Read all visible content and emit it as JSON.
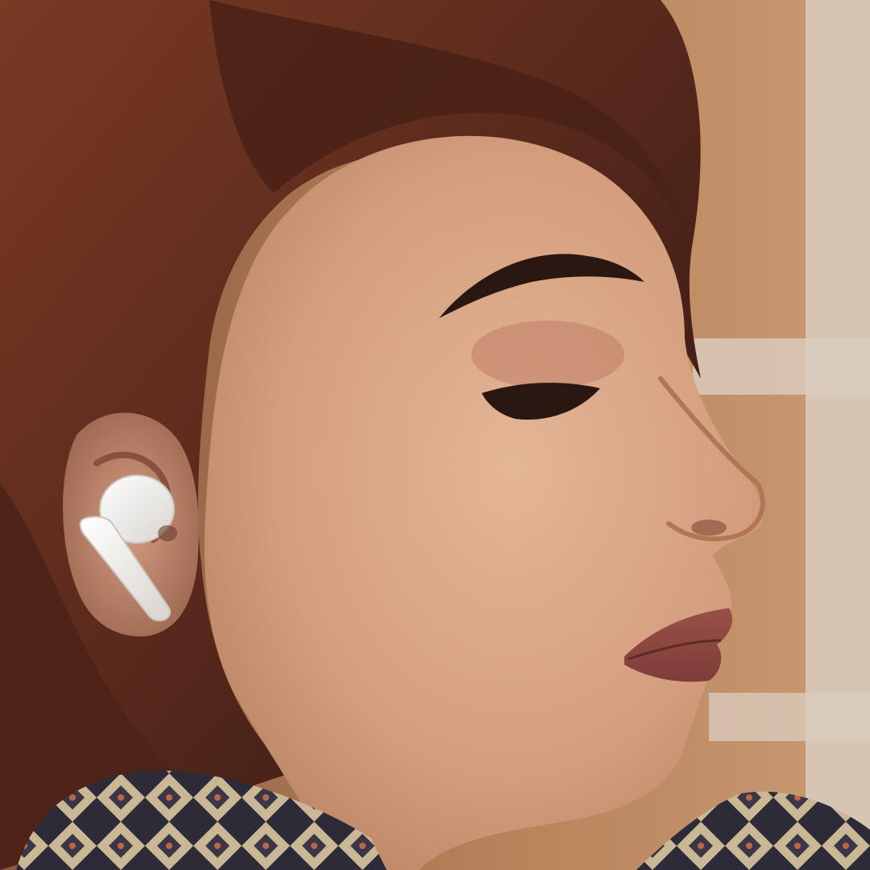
{
  "photo": {
    "subject": "woman-wearing-wireless-earbud",
    "palette": {
      "background": "#b8845c",
      "wall_light": "#d9cdbf",
      "hair": "#5a2a1c",
      "skin": "#d9a585",
      "earbud": "#f4f1ee",
      "lips": "#8e4a45",
      "scarf_dark": "#2d2b38",
      "scarf_light": "#c9b795"
    }
  }
}
